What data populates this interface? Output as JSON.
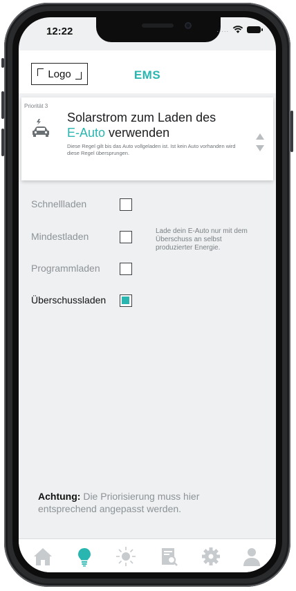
{
  "status_bar": {
    "time": "12:22",
    "signal_dots": "....."
  },
  "header": {
    "logo_label": "Logo",
    "title": "EMS"
  },
  "rule": {
    "priority_label": "Priorität 3",
    "title_line1": "Solarstrom zum Laden des",
    "title_accent": "E-Auto",
    "title_rest": "verwenden",
    "description": "Diese Regel gilt bis das Auto vollgeladen ist. Ist kein Auto vorhanden wird diese Regel übersprungen."
  },
  "options": [
    {
      "label": "Schnellladen",
      "checked": false
    },
    {
      "label": "Mindestladen",
      "checked": false
    },
    {
      "label": "Programmladen",
      "checked": false
    },
    {
      "label": "Überschussladen",
      "checked": true
    }
  ],
  "info_text": "Lade dein E-Auto nur mit dem Überschuss an selbst produzierter Energie.",
  "warning": {
    "emphasis": "Achtung:",
    "text": "Die Priorisierung muss hier entsprechend angepasst werden."
  },
  "tabs": [
    {
      "icon": "home-icon",
      "active": false
    },
    {
      "icon": "lightbulb-icon",
      "active": true
    },
    {
      "icon": "sun-icon",
      "active": false
    },
    {
      "icon": "report-search-icon",
      "active": false
    },
    {
      "icon": "gear-icon",
      "active": false
    },
    {
      "icon": "user-icon",
      "active": false
    }
  ],
  "colors": {
    "accent": "#29b6b0",
    "inactive_icon": "#c7cbce",
    "text_muted": "#8d9296"
  }
}
